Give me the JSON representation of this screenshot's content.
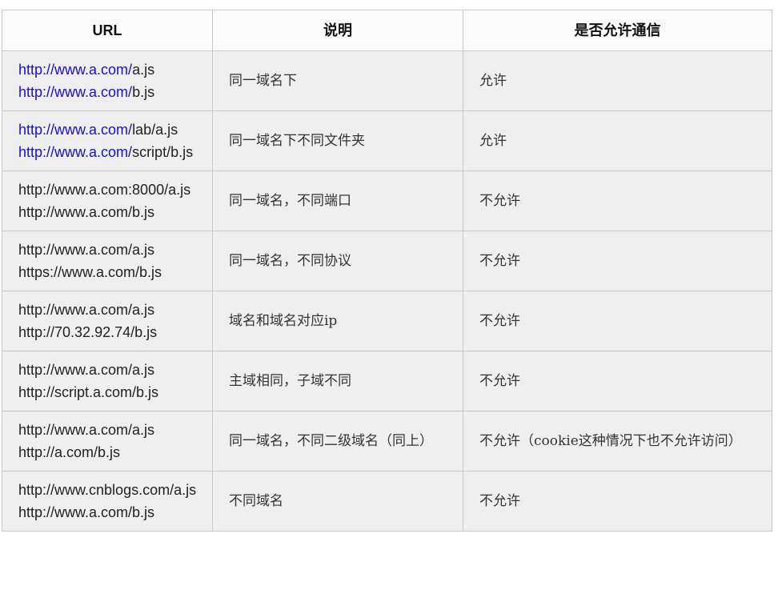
{
  "headers": {
    "url": "URL",
    "desc": "说明",
    "allow": "是否允许通信"
  },
  "colors": {
    "link": "#1a0dcc",
    "row_bg": "#efefef",
    "header_bg": "#fbfbfb",
    "border": "#c8c8c8"
  },
  "rows": [
    {
      "urls": [
        {
          "link": "http://www.a.com/",
          "rest": "a.js"
        },
        {
          "link": "http://www.a.com/",
          "rest": "b.js"
        }
      ],
      "desc": "同一域名下",
      "allow": "允许"
    },
    {
      "urls": [
        {
          "link": "http://www.a.com/",
          "rest": "lab/a.js"
        },
        {
          "link": "http://www.a.com/",
          "rest": "script/b.js"
        }
      ],
      "desc": "同一域名下不同文件夹",
      "allow": "允许"
    },
    {
      "urls": [
        {
          "link": "",
          "rest": "http://www.a.com:8000/a.js"
        },
        {
          "link": "",
          "rest": "http://www.a.com/b.js"
        }
      ],
      "desc": "同一域名，不同端口",
      "allow": "不允许"
    },
    {
      "urls": [
        {
          "link": "",
          "rest": "http://www.a.com/a.js"
        },
        {
          "link": "",
          "rest": "https://www.a.com/b.js"
        }
      ],
      "desc": "同一域名，不同协议",
      "allow": "不允许"
    },
    {
      "urls": [
        {
          "link": "",
          "rest": "http://www.a.com/a.js"
        },
        {
          "link": "",
          "rest": "http://70.32.92.74/b.js"
        }
      ],
      "desc": "域名和域名对应ip",
      "allow": "不允许"
    },
    {
      "urls": [
        {
          "link": "",
          "rest": "http://www.a.com/a.js"
        },
        {
          "link": "",
          "rest": "http://script.a.com/b.js"
        }
      ],
      "desc": "主域相同，子域不同",
      "allow": "不允许"
    },
    {
      "urls": [
        {
          "link": "",
          "rest": "http://www.a.com/a.js"
        },
        {
          "link": "",
          "rest": "http://a.com/b.js"
        }
      ],
      "desc": "同一域名，不同二级域名（同上）",
      "allow": "不允许（cookie这种情况下也不允许访问）"
    },
    {
      "urls": [
        {
          "link": "",
          "rest": "http://www.cnblogs.com/a.js"
        },
        {
          "link": "",
          "rest": "http://www.a.com/b.js"
        }
      ],
      "desc": "不同域名",
      "allow": "不允许"
    }
  ]
}
